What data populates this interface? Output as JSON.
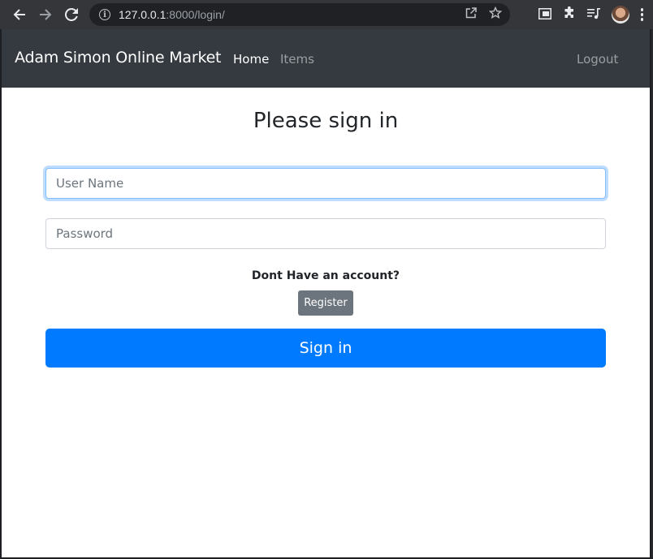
{
  "browser": {
    "url_host": "127.0.0.1",
    "url_rest": ":8000/login/"
  },
  "navbar": {
    "brand": "Adam Simon Online Market",
    "links": [
      {
        "label": "Home"
      },
      {
        "label": "Items"
      },
      {
        "label": "Logout"
      }
    ]
  },
  "form": {
    "heading": "Please sign in",
    "username_placeholder": "User Name",
    "password_placeholder": "Password",
    "account_prompt": "Dont Have an account?",
    "register_label": "Register",
    "signin_label": "Sign in"
  },
  "colors": {
    "navbar_bg": "#343a40",
    "primary": "#007bff",
    "secondary": "#6c757d"
  },
  "icons": [
    "back-icon",
    "forward-icon",
    "reload-icon",
    "site-info-icon",
    "share-icon",
    "bookmark-star-icon",
    "sidebar-icon",
    "extensions-icon",
    "media-queue-icon",
    "profile-avatar",
    "menu-kebab-icon"
  ]
}
